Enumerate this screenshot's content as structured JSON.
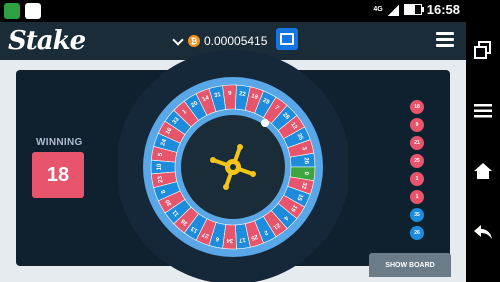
{
  "status_bar": {
    "time": "16:58",
    "network": "4G",
    "left_icons": [
      "notification-app-icon",
      "notes-app-icon"
    ]
  },
  "header": {
    "logo": "Stake",
    "balance": "0.00005415",
    "currency_icon": "bitcoin-icon",
    "wallet_icon": "wallet-icon",
    "menu_icon": "hamburger-menu-icon"
  },
  "game": {
    "winning_label": "WINNING",
    "winning_number": "18",
    "winning_color": "#e6556c",
    "pockets": [
      {
        "n": "10",
        "c": "blue"
      },
      {
        "n": "5",
        "c": "red"
      },
      {
        "n": "24",
        "c": "blue"
      },
      {
        "n": "16",
        "c": "red"
      },
      {
        "n": "33",
        "c": "blue"
      },
      {
        "n": "1",
        "c": "red"
      },
      {
        "n": "20",
        "c": "blue"
      },
      {
        "n": "14",
        "c": "red"
      },
      {
        "n": "31",
        "c": "blue"
      },
      {
        "n": "9",
        "c": "red"
      },
      {
        "n": "22",
        "c": "blue"
      },
      {
        "n": "18",
        "c": "red"
      },
      {
        "n": "29",
        "c": "blue"
      },
      {
        "n": "7",
        "c": "red"
      },
      {
        "n": "28",
        "c": "blue"
      },
      {
        "n": "12",
        "c": "red"
      },
      {
        "n": "35",
        "c": "blue"
      },
      {
        "n": "3",
        "c": "red"
      },
      {
        "n": "26",
        "c": "blue"
      },
      {
        "n": "0",
        "c": "green"
      },
      {
        "n": "32",
        "c": "red"
      },
      {
        "n": "15",
        "c": "blue"
      },
      {
        "n": "19",
        "c": "red"
      },
      {
        "n": "4",
        "c": "blue"
      },
      {
        "n": "21",
        "c": "red"
      },
      {
        "n": "2",
        "c": "blue"
      },
      {
        "n": "25",
        "c": "red"
      },
      {
        "n": "17",
        "c": "blue"
      },
      {
        "n": "34",
        "c": "red"
      },
      {
        "n": "6",
        "c": "blue"
      },
      {
        "n": "27",
        "c": "red"
      },
      {
        "n": "13",
        "c": "blue"
      },
      {
        "n": "36",
        "c": "red"
      },
      {
        "n": "11",
        "c": "blue"
      },
      {
        "n": "30",
        "c": "red"
      },
      {
        "n": "8",
        "c": "blue"
      },
      {
        "n": "23",
        "c": "red"
      }
    ],
    "pocket_colors": {
      "red": "#e6556c",
      "blue": "#1e8cdc",
      "green": "#3fa63f"
    },
    "history": [
      {
        "n": "18",
        "c": "red"
      },
      {
        "n": "9",
        "c": "red"
      },
      {
        "n": "21",
        "c": "red"
      },
      {
        "n": "25",
        "c": "red"
      },
      {
        "n": "1",
        "c": "red"
      },
      {
        "n": "1",
        "c": "red"
      },
      {
        "n": "35",
        "c": "blue"
      },
      {
        "n": "26",
        "c": "blue"
      }
    ],
    "show_board_label": "SHOW BOARD"
  },
  "nav_bar": {
    "icons": [
      "recent-apps-icon",
      "menu-icon",
      "home-icon",
      "back-icon"
    ]
  }
}
